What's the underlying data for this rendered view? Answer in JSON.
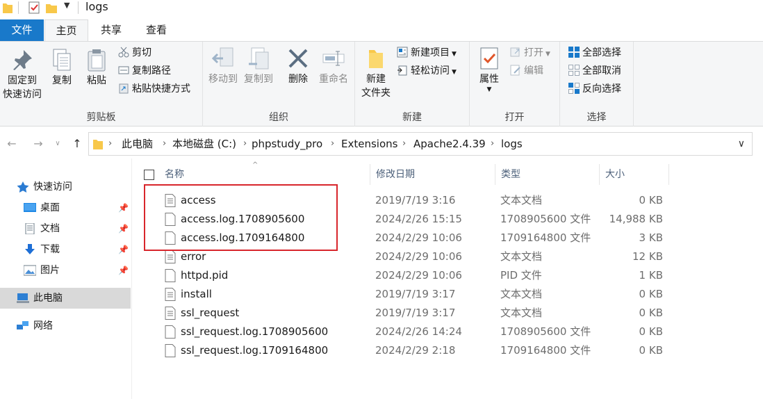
{
  "window": {
    "title": "logs"
  },
  "tabs": {
    "file": "文件",
    "home": "主页",
    "share": "共享",
    "view": "查看"
  },
  "ribbon": {
    "clipboard": {
      "label": "剪贴板",
      "pin_quick_access": [
        "固定到",
        "快速访问"
      ],
      "copy": "复制",
      "paste": "粘贴",
      "cut": "剪切",
      "copy_path": "复制路径",
      "paste_shortcut": "粘贴快捷方式"
    },
    "organize": {
      "label": "组织",
      "move_to": "移动到",
      "copy_to": "复制到",
      "delete": "删除",
      "rename": "重命名"
    },
    "new": {
      "label": "新建",
      "new_folder": [
        "新建",
        "文件夹"
      ],
      "new_item": "新建项目",
      "easy_access": "轻松访问"
    },
    "open": {
      "label": "打开",
      "properties": "属性",
      "open": "打开",
      "edit": "编辑"
    },
    "select": {
      "label": "选择",
      "select_all": "全部选择",
      "select_none": "全部取消",
      "invert_selection": "反向选择"
    }
  },
  "address": {
    "crumbs": [
      "此电脑",
      "本地磁盘 (C:)",
      "phpstudy_pro",
      "Extensions",
      "Apache2.4.39",
      "logs"
    ]
  },
  "navpane": {
    "quick_access": "快速访问",
    "desktop": "桌面",
    "documents": "文档",
    "downloads": "下载",
    "pictures": "图片",
    "this_pc": "此电脑",
    "network": "网络"
  },
  "columns": {
    "name": "名称",
    "date": "修改日期",
    "type": "类型",
    "size": "大小"
  },
  "files": [
    {
      "name": "access",
      "date": "2019/7/19 3:16",
      "type": "文本文档",
      "size": "0 KB"
    },
    {
      "name": "access.log.1708905600",
      "date": "2024/2/26 15:15",
      "type": "1708905600 文件",
      "size": "14,988 KB"
    },
    {
      "name": "access.log.1709164800",
      "date": "2024/2/29 10:06",
      "type": "1709164800 文件",
      "size": "3 KB"
    },
    {
      "name": "error",
      "date": "2024/2/29 10:06",
      "type": "文本文档",
      "size": "12 KB"
    },
    {
      "name": "httpd.pid",
      "date": "2024/2/29 10:06",
      "type": "PID 文件",
      "size": "1 KB"
    },
    {
      "name": "install",
      "date": "2019/7/19 3:17",
      "type": "文本文档",
      "size": "0 KB"
    },
    {
      "name": "ssl_request",
      "date": "2019/7/19 3:17",
      "type": "文本文档",
      "size": "0 KB"
    },
    {
      "name": "ssl_request.log.1708905600",
      "date": "2024/2/26 14:24",
      "type": "1708905600 文件",
      "size": "0 KB"
    },
    {
      "name": "ssl_request.log.1709164800",
      "date": "2024/2/29 2:18",
      "type": "1709164800 文件",
      "size": "0 KB"
    }
  ],
  "colors": {
    "accent": "#1979ca",
    "folder": "#f8c84a",
    "highlight": "#d8252b",
    "selected_nav": "#d9d9d9"
  }
}
